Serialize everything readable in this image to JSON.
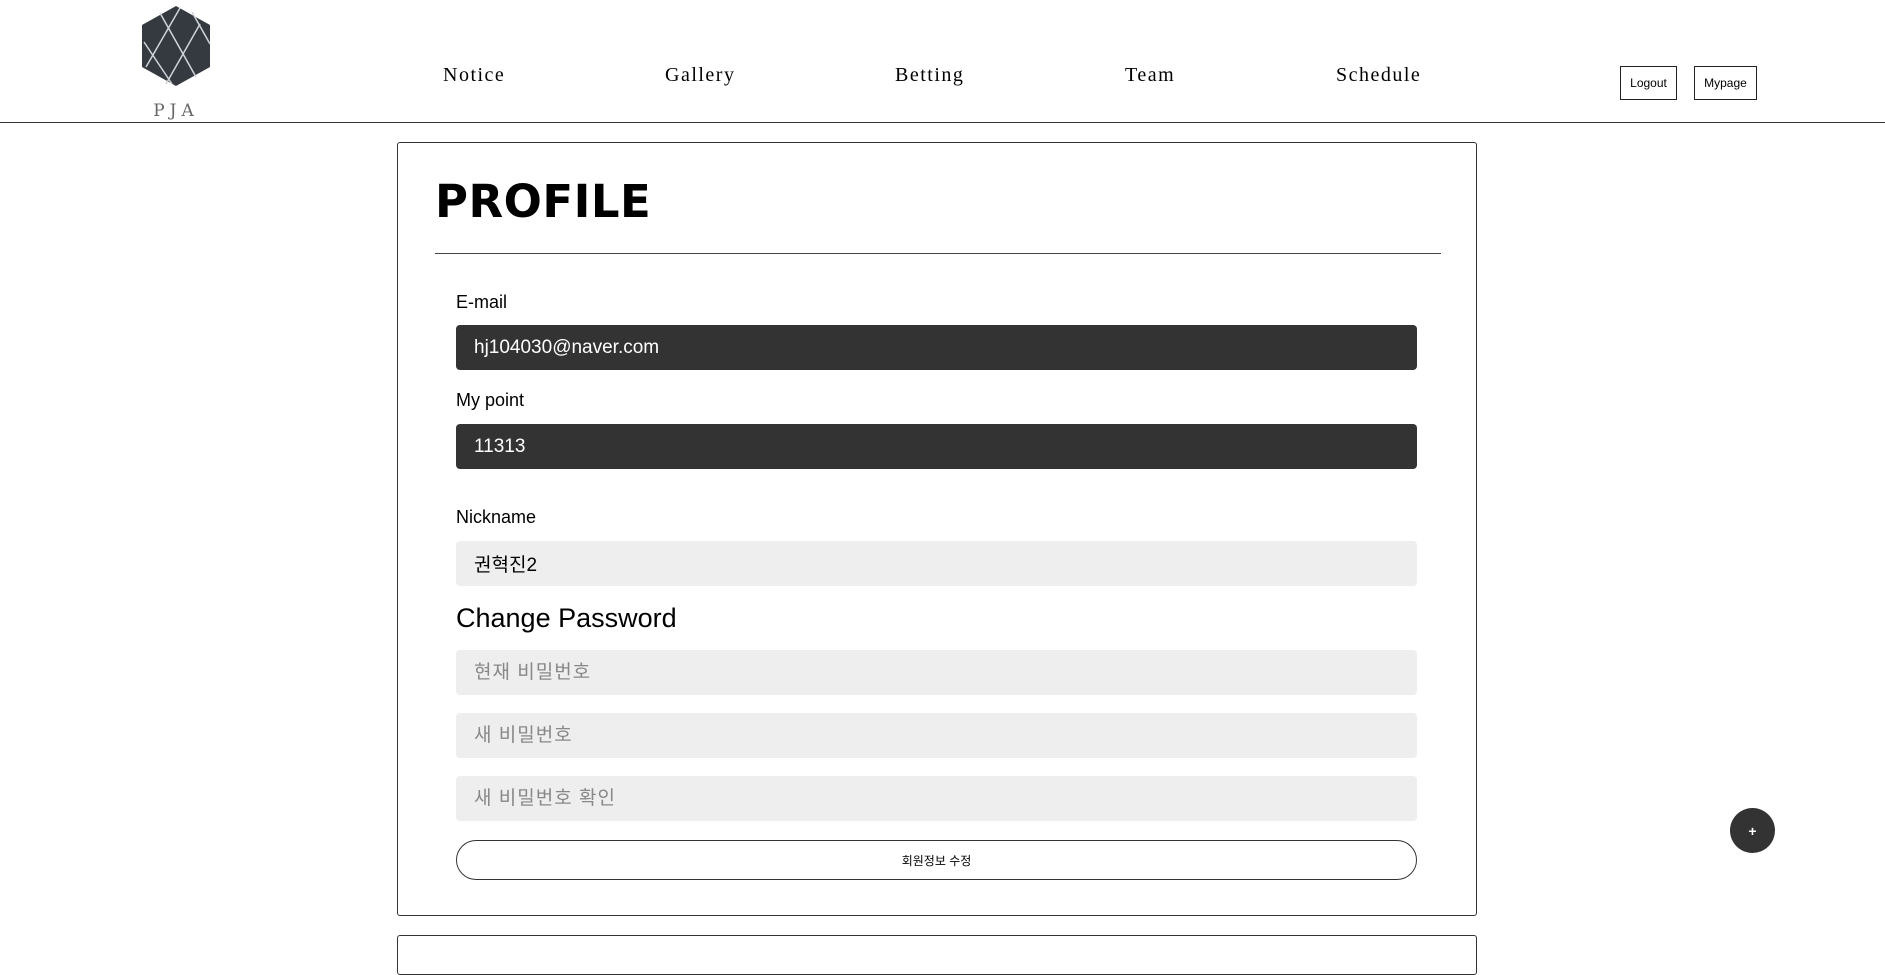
{
  "header": {
    "logo_text": "PJA",
    "nav": [
      "Notice",
      "Gallery",
      "Betting",
      "Team",
      "Schedule"
    ],
    "logout_label": "Logout",
    "mypage_label": "Mypage"
  },
  "profile": {
    "title": "PROFILE",
    "email_label": "E-mail",
    "email_value": "hj104030@naver.com",
    "point_label": "My point",
    "point_value": "11313",
    "nickname_label": "Nickname",
    "nickname_value": "권혁진2",
    "change_password_heading": "Change Password",
    "current_password_placeholder": "현재 비밀번호",
    "new_password_placeholder": "새 비밀번호",
    "confirm_password_placeholder": "새 비밀번호 확인",
    "submit_label": "회원정보 수정"
  },
  "fab_label": "+",
  "colors": {
    "dark_field": "#333333",
    "light_field": "#eeeeee"
  }
}
